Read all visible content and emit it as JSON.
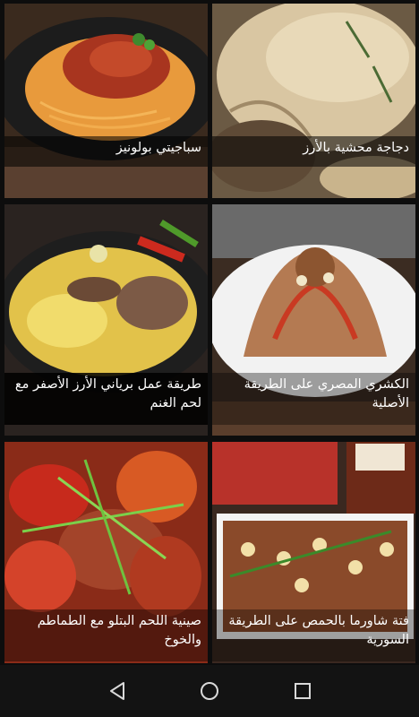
{
  "recipes": [
    {
      "title": "سباجيتي بولونيز",
      "image": "spaghetti-bolognese-photo"
    },
    {
      "title": "دجاجة محشية بالأرز",
      "image": "stuffed-chicken-rice-photo"
    },
    {
      "title": "طريقة عمل برياني الأرز الأصفر مع لحم الغنم",
      "image": "lamb-biryani-photo"
    },
    {
      "title": "الكشري المصري على الطريقة الأصلية",
      "image": "egyptian-koshary-photo"
    },
    {
      "title": "صينية اللحم البتلو مع الطماطم والخوخ",
      "image": "veal-tomato-peach-tray-photo"
    },
    {
      "title": "فتة شاورما بالحمص على الطريقة السورية",
      "image": "shawarma-fatteh-chickpeas-photo"
    }
  ],
  "navbar": {
    "back_icon": "back-triangle-icon",
    "home_icon": "home-circle-icon",
    "recents_icon": "recents-square-icon"
  },
  "colors": {
    "background": "#0d0d0d",
    "caption_overlay": "rgba(0,0,0,0.62)",
    "caption_text": "#ffffff",
    "navbar": "#131313"
  }
}
